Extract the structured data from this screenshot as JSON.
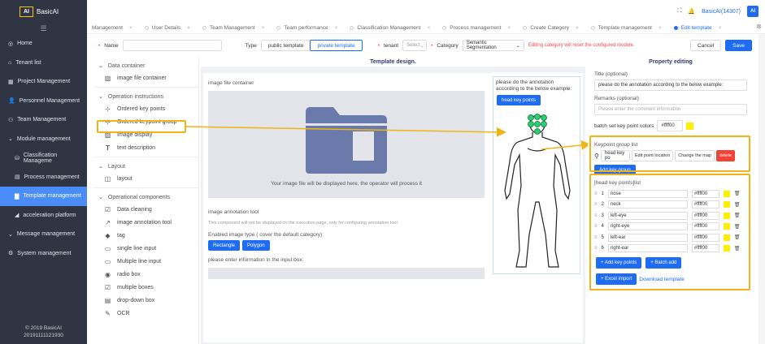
{
  "app": {
    "logo_mark": "AI",
    "logo_text": "BasicAI"
  },
  "sidebar": {
    "items": [
      {
        "label": "Home",
        "icon": "home-icon",
        "glyph": "◎"
      },
      {
        "label": "Tenant list",
        "icon": "tenant-icon",
        "glyph": "⌂"
      },
      {
        "label": "Project Management",
        "icon": "project-icon",
        "glyph": "▦"
      },
      {
        "label": "Personnel Management",
        "icon": "person-icon",
        "glyph": "👤"
      },
      {
        "label": "Team Management",
        "icon": "team-icon",
        "glyph": "⚇"
      },
      {
        "label": "Module management",
        "icon": "module-icon",
        "glyph": "⌄"
      },
      {
        "label": "Classification Manageme",
        "icon": "classification-icon",
        "glyph": "⛁"
      },
      {
        "label": "Process management",
        "icon": "process-icon",
        "glyph": "▤"
      },
      {
        "label": "Template management",
        "icon": "template-icon",
        "glyph": "▇"
      },
      {
        "label": "acceleration platform",
        "icon": "acceleration-icon",
        "glyph": "◢"
      },
      {
        "label": "Message management",
        "icon": "message-icon",
        "glyph": "⌄"
      },
      {
        "label": "System management",
        "icon": "system-icon",
        "glyph": "⚙"
      }
    ],
    "copyright": "© 2019 BasicAI",
    "build": "20191111121930"
  },
  "topbar": {
    "user": "BasicAI(14307)",
    "avatar": "AI"
  },
  "tabs": [
    {
      "label": "Management"
    },
    {
      "label": "User Details"
    },
    {
      "label": "Team Management"
    },
    {
      "label": "Team performance"
    },
    {
      "label": "Classification Management"
    },
    {
      "label": "Process management"
    },
    {
      "label": "Create Category"
    },
    {
      "label": "Template management"
    },
    {
      "label": "Edit template"
    }
  ],
  "form": {
    "name_label": "Name",
    "type_label": "Type",
    "type_public": "public template",
    "type_private": "private template",
    "tenant_label": "tenant",
    "tenant_placeholder": "Select",
    "category_label": "Category",
    "category_value": "Semantic Segmentation",
    "warning": "Editing category will reset the configured module.",
    "cancel": "Cancel",
    "save": "Save"
  },
  "components": {
    "data_container": "Data container",
    "image_file_container": "image file container",
    "operation_instructions": "Operation instructions",
    "ordered_key_points": "Ordered key points",
    "ordered_keypoint_group": "Ordered keypoint group",
    "image_display": "Image display",
    "text_description": "text description",
    "layout": "Layout",
    "layout_item": "layout",
    "operational": "Operational components",
    "ops": [
      {
        "label": "Data cleaning",
        "icon": "check-icon",
        "glyph": "☑"
      },
      {
        "label": "image annotation tool",
        "icon": "pen-icon",
        "glyph": "↗"
      },
      {
        "label": "tag",
        "icon": "tag-icon",
        "glyph": "◆"
      },
      {
        "label": "single line input",
        "icon": "input-icon",
        "glyph": "▭"
      },
      {
        "label": "Multiple line input",
        "icon": "textarea-icon",
        "glyph": "▭"
      },
      {
        "label": "radio box",
        "icon": "radio-icon",
        "glyph": "◉"
      },
      {
        "label": "multiple boxes",
        "icon": "checkbox-icon",
        "glyph": "☑"
      },
      {
        "label": "drop-down box",
        "icon": "dropdown-icon",
        "glyph": "▤"
      },
      {
        "label": "OCR",
        "icon": "ocr-icon",
        "glyph": "✎"
      }
    ]
  },
  "design": {
    "title": "Template design.",
    "img_label": "image file container",
    "img_caption": "Your image file will be displayed here, the operator will process it",
    "tool_label": "image annotation tool",
    "tool_note": "This component will not be displayed on the execution page, only for configuring annotation tool.",
    "enabled_label": "Enabled image type ( cover the default category):",
    "types": [
      "Rectangle",
      "Polygon"
    ],
    "input_label": "please enter information in the input box:",
    "preview_note": "please do the annotation according to the below example:",
    "preview_button": "head key points"
  },
  "props": {
    "title": "Property editing",
    "title_label": "Title (optional)",
    "title_value": "please do the annotation according to the below example:",
    "remarks_label": "Remarks (optional)",
    "remarks_placeholder": "Please enter the comment information",
    "batch_label": "batch set key point colors",
    "batch_color": "#ffff00",
    "group_list_label": "Keypoint group list",
    "group_name": "head key po",
    "edit_loc": "Edit point location",
    "change_map": "Change the map",
    "delete": "delete",
    "add_group": "Add key group",
    "points_label": "[head key points]list",
    "points": [
      {
        "n": "1",
        "name": "nose",
        "color": "#ffff00"
      },
      {
        "n": "2",
        "name": "neck",
        "color": "#ffff00"
      },
      {
        "n": "3",
        "name": "left-eye",
        "color": "#ffff00"
      },
      {
        "n": "4",
        "name": "right-eye",
        "color": "#ffff00"
      },
      {
        "n": "5",
        "name": "left-ear",
        "color": "#ffff00"
      },
      {
        "n": "6",
        "name": "right-ear",
        "color": "#ffff00"
      }
    ],
    "add_points": "+ Add key points",
    "batch_add": "+ Batch add",
    "excel_import": "+ Excel import",
    "download": "Download template"
  },
  "colors": {
    "accent": "#1e6cf3",
    "highlight": "#f0b417",
    "sidebar": "#2f3542",
    "danger": "#f44336"
  }
}
